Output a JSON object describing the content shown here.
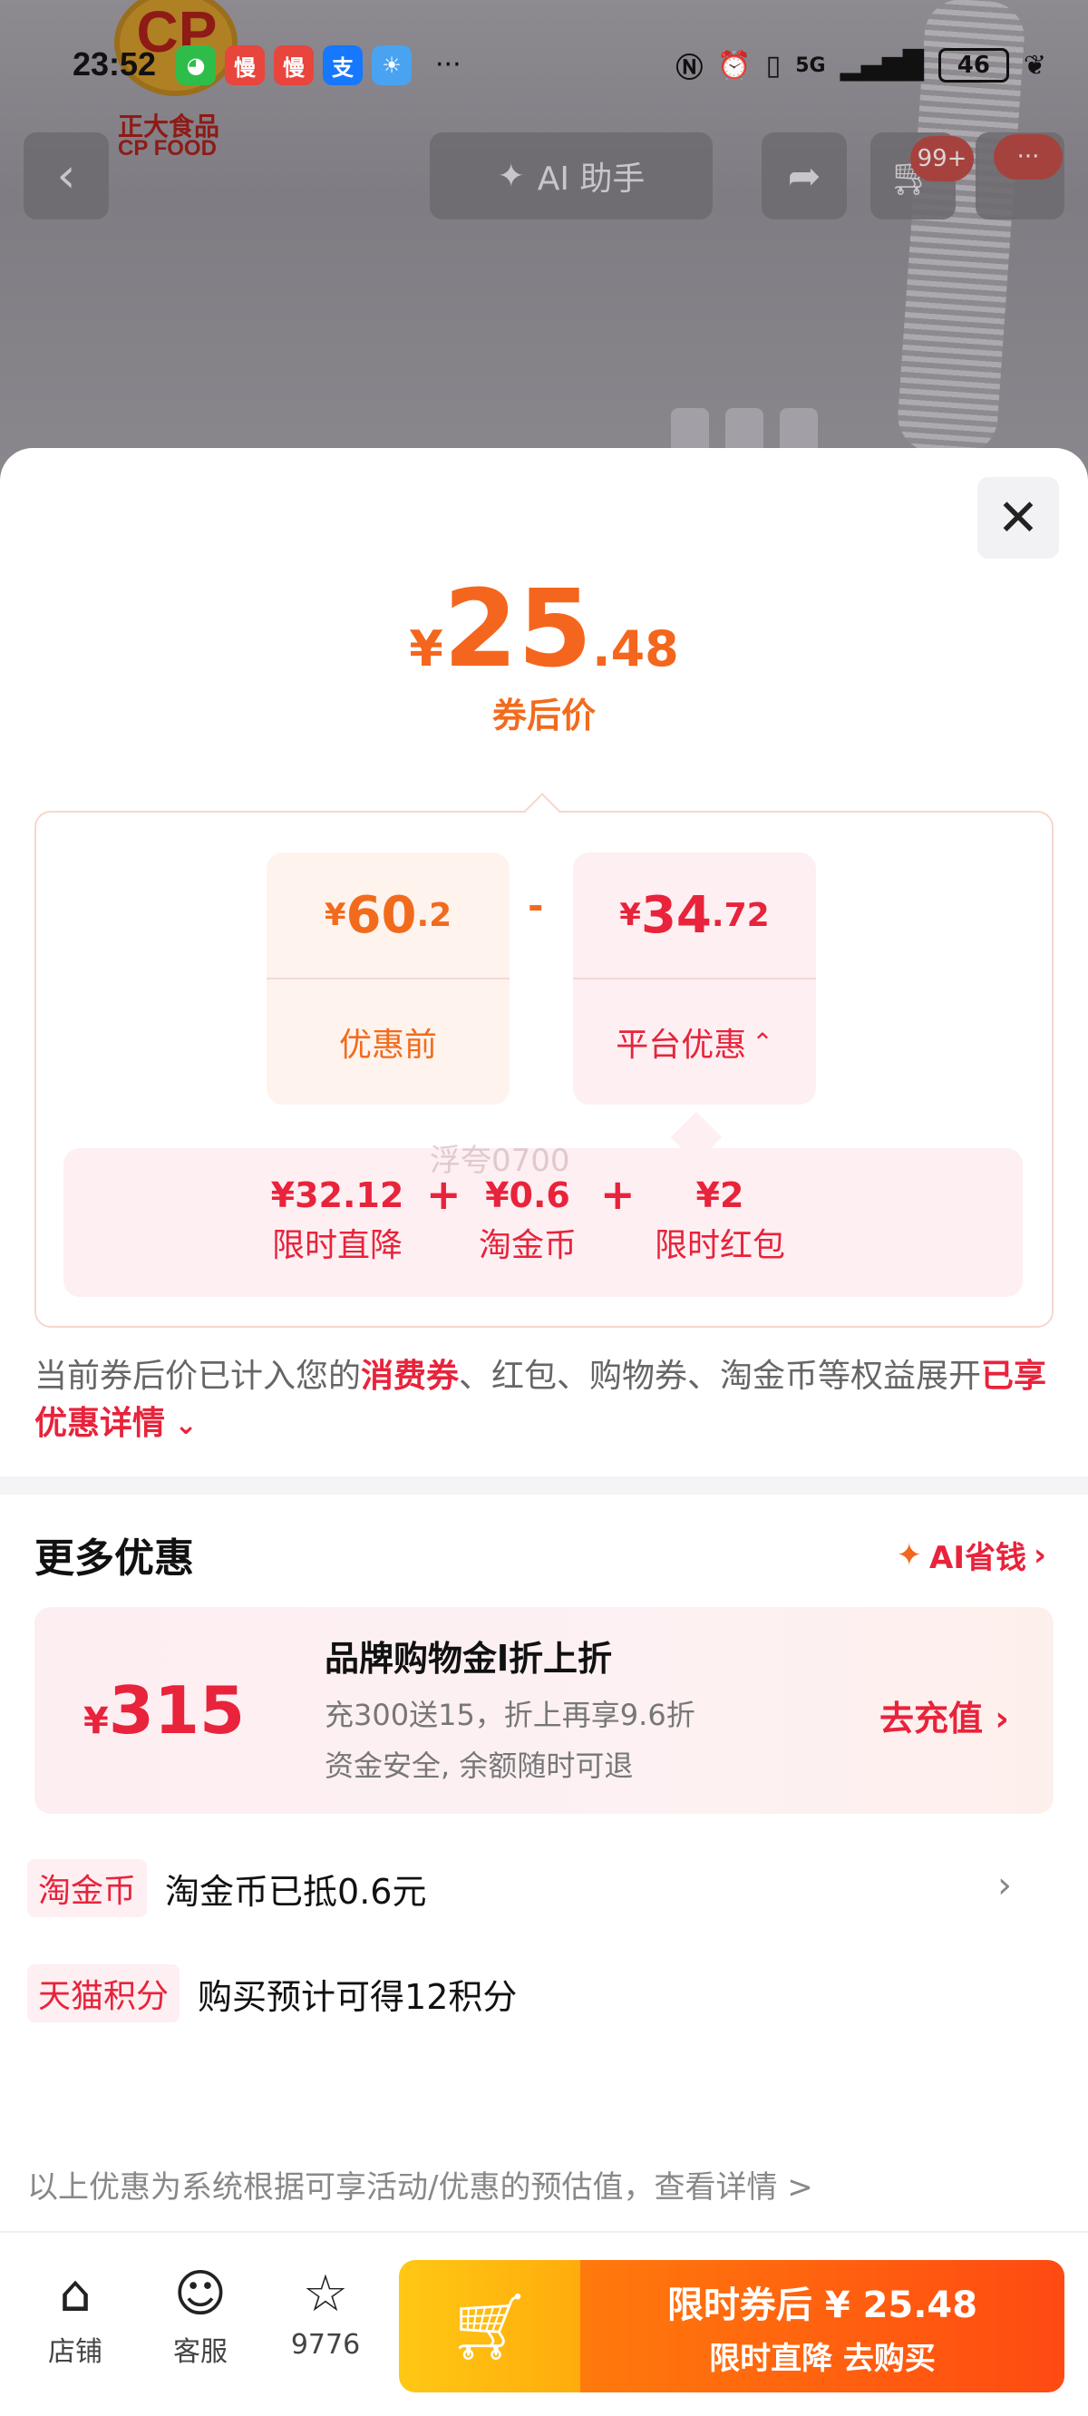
{
  "status_bar": {
    "time": "23:52",
    "apps": [
      {
        "icon": "wechat-icon",
        "glyph": "◕",
        "color": "#2fbd4a"
      },
      {
        "icon": "app-man-icon",
        "glyph": "慢",
        "color": "#e8453c"
      },
      {
        "icon": "app-man-icon",
        "glyph": "慢",
        "color": "#e8453c"
      },
      {
        "icon": "alipay-icon",
        "glyph": "支",
        "color": "#1677ff"
      },
      {
        "icon": "weather-icon",
        "glyph": "☀",
        "color": "#4aa3f0"
      }
    ],
    "more": "···",
    "battery": "46",
    "network": "5G"
  },
  "brand": {
    "logo_text": "CP",
    "name_cn": "正大食品",
    "name_en": "CP FOOD"
  },
  "nav": {
    "ai_label": "AI 助手",
    "cart_badge": "99+",
    "more_badge": "···"
  },
  "price_sheet": {
    "final_price": {
      "currency": "¥",
      "int": "25",
      "dec": ".48"
    },
    "final_label": "券后价",
    "original": {
      "currency": "¥",
      "int": "60",
      "dec": ".2",
      "label": "优惠前"
    },
    "minus": "-",
    "discount": {
      "currency": "¥",
      "int": "34",
      "dec": ".72",
      "label": "平台优惠"
    },
    "breakdown": [
      {
        "value": "¥32.12",
        "label": "限时直降"
      },
      {
        "value": "¥0.6",
        "label": "淘金币"
      },
      {
        "value": "¥2",
        "label": "限时红包"
      }
    ],
    "plus": "+",
    "watermark": "浮夸0700",
    "explain_pre": "当前券后价已计入您的",
    "explain_red1": "消费券",
    "explain_mid": "、红包、购物券、淘金币等权益展开",
    "explain_red2": "已享优惠详情"
  },
  "more_offers": {
    "title": "更多优惠",
    "ai_save": "AI省钱",
    "promo": {
      "currency": "¥",
      "amount": "315",
      "title": "品牌购物金l折上折",
      "desc1": "充300送15，折上再享9.6折",
      "desc2": "资金安全, 余额随时可退",
      "action": "去充值"
    },
    "rows": [
      {
        "tag": "淘金币",
        "text": "淘金币已抵0.6元"
      },
      {
        "tag": "天猫积分",
        "text": "购买预计可得12积分"
      }
    ],
    "disclaimer": "以上优惠为系统根据可享活动/优惠的预估值，查看详情 >"
  },
  "bottom_bar": {
    "store_label": "店铺",
    "service_label": "客服",
    "favorite_count": "9776",
    "buy_line1": "限时券后 ¥ 25.48",
    "buy_line2": "限时直降 去购买"
  }
}
